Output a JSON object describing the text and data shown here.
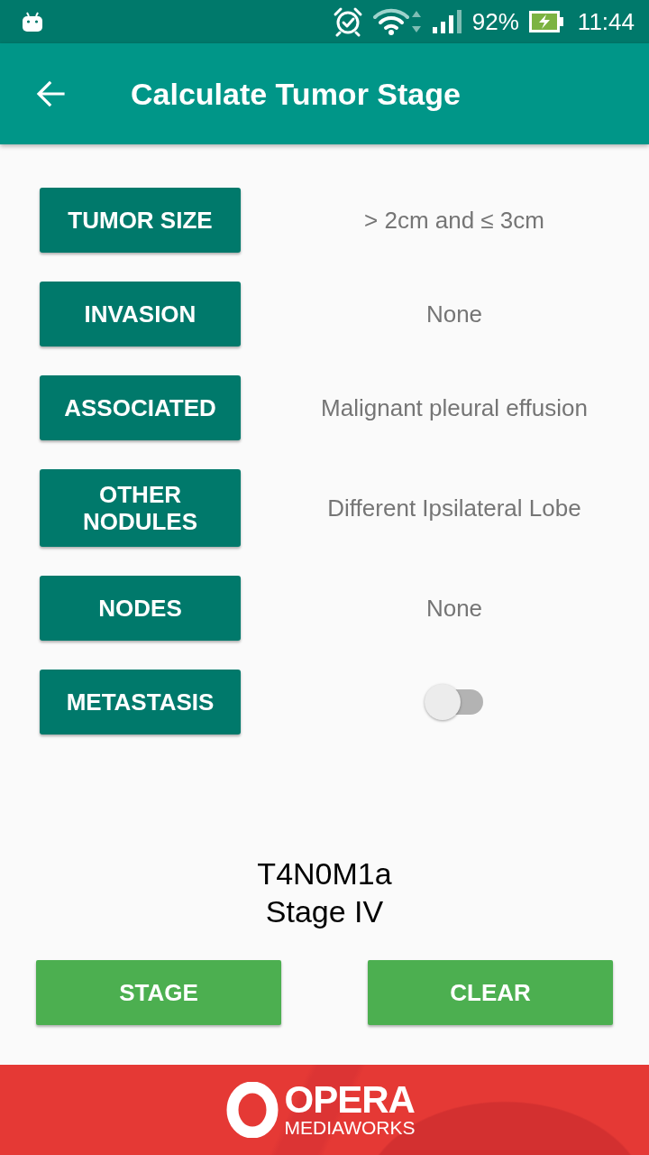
{
  "status_bar": {
    "battery": "92%",
    "time": "11:44"
  },
  "toolbar": {
    "title": "Calculate Tumor Stage"
  },
  "criteria": [
    {
      "label": "TUMOR SIZE",
      "kind": "value",
      "value": "> 2cm and ≤ 3cm"
    },
    {
      "label": "INVASION",
      "kind": "value",
      "value": "None"
    },
    {
      "label": "ASSOCIATED",
      "kind": "value",
      "value": "Malignant pleural effusion"
    },
    {
      "label": "OTHER NODULES",
      "kind": "value",
      "value": "Different Ipsilateral Lobe"
    },
    {
      "label": "NODES",
      "kind": "value",
      "value": "None"
    },
    {
      "label": "METASTASIS",
      "kind": "switch",
      "on": false
    }
  ],
  "result": {
    "code": "T4N0M1a",
    "stage": "Stage IV"
  },
  "actions": [
    {
      "label": "STAGE"
    },
    {
      "label": "CLEAR"
    }
  ],
  "ad_banner": {
    "brand": "OPERA",
    "tagline": "MEDIAWORKS"
  }
}
